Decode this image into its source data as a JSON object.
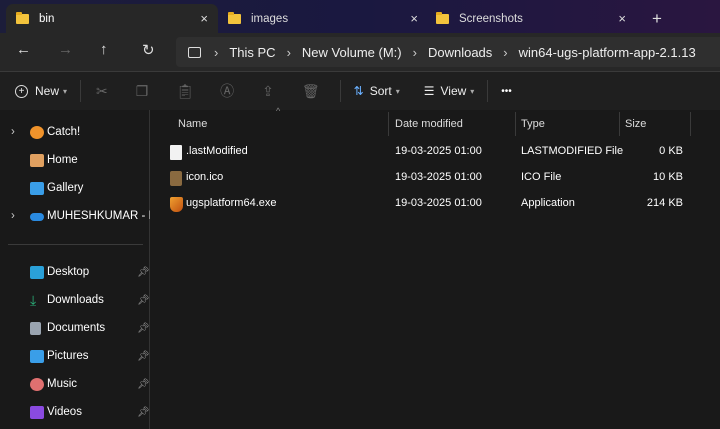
{
  "tabs": [
    {
      "label": "bin",
      "active": true
    },
    {
      "label": "images"
    },
    {
      "label": "Screenshots"
    }
  ],
  "new_tab": "+",
  "close": "×",
  "nav": {
    "back": "←",
    "forward": "→",
    "up": "↑",
    "refresh": "↻"
  },
  "breadcrumb": [
    "This PC",
    "New Volume (M:)",
    "Downloads",
    "win64-ugs-platform-app-2.1.13"
  ],
  "breadcrumb_sep": "›",
  "toolbar": {
    "new": "New",
    "sort": "Sort",
    "view": "View",
    "more": "•••"
  },
  "sidebar": {
    "items": [
      {
        "label": "Catch!",
        "expandable": true,
        "color": "#f0932b"
      },
      {
        "label": "Home",
        "color": "#e0a060"
      },
      {
        "label": "Gallery",
        "color": "#3a9ee8"
      },
      {
        "label": "MUHESHKUMAR - Personal",
        "expandable": true,
        "color": "#2a8ae0"
      }
    ],
    "quick": [
      {
        "label": "Desktop",
        "color": "#2aa0d8"
      },
      {
        "label": "Downloads",
        "color": "#2ab27a"
      },
      {
        "label": "Documents",
        "color": "#9aa4b0"
      },
      {
        "label": "Pictures",
        "color": "#3a9ee8"
      },
      {
        "label": "Music",
        "color": "#e07070"
      },
      {
        "label": "Videos",
        "color": "#8a4ae0"
      }
    ]
  },
  "columns": [
    "Name",
    "Date modified",
    "Type",
    "Size"
  ],
  "files": [
    {
      "name": ".lastModified",
      "date": "19-03-2025 01:00",
      "type": "LASTMODIFIED File",
      "size": "0 KB",
      "icon": "file-icon"
    },
    {
      "name": "icon.ico",
      "date": "19-03-2025 01:00",
      "type": "ICO File",
      "size": "10 KB",
      "icon": "ico-icon"
    },
    {
      "name": "ugsplatform64.exe",
      "date": "19-03-2025 01:00",
      "type": "Application",
      "size": "214 KB",
      "icon": "app-icon"
    }
  ]
}
